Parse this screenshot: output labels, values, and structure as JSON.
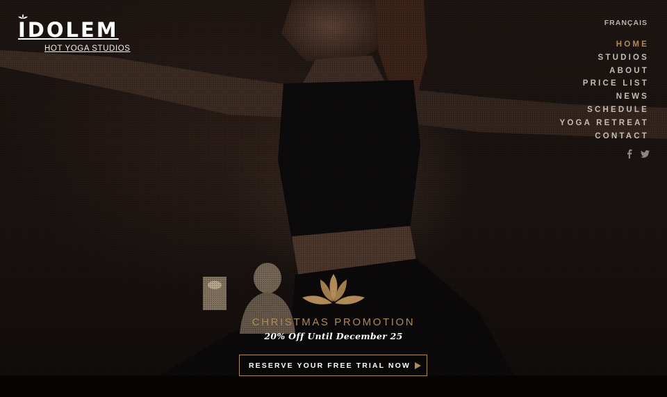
{
  "brand": {
    "name": "IDOLEM",
    "tagline": "HOT YOGA STUDIOS"
  },
  "language_link": "FRANÇAIS",
  "nav": {
    "items": [
      {
        "label": "HOME",
        "active": true
      },
      {
        "label": "STUDIOS",
        "active": false
      },
      {
        "label": "ABOUT",
        "active": false
      },
      {
        "label": "PRICE LIST",
        "active": false
      },
      {
        "label": "NEWS",
        "active": false
      },
      {
        "label": "SCHEDULE",
        "active": false
      },
      {
        "label": "YOGA RETREAT",
        "active": false
      },
      {
        "label": "CONTACT",
        "active": false
      }
    ]
  },
  "social": {
    "icons": [
      "facebook-icon",
      "twitter-icon"
    ]
  },
  "top_print": "IDOLEM",
  "promo": {
    "icon": "lotus-icon",
    "title": "CHRISTMAS PROMOTION",
    "subtitle": "20% Off Until December 25",
    "cta_label": "RESERVE YOUR FREE TRIAL NOW"
  },
  "colors": {
    "accent": "#b08a57",
    "nav_text": "#c3bdb6",
    "background": "#181210"
  }
}
